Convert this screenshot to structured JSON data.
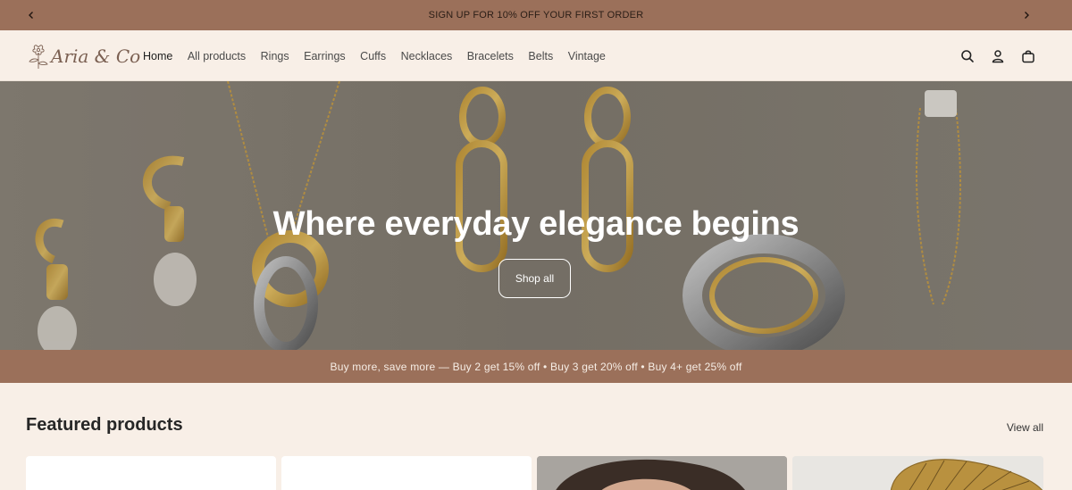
{
  "announcement": {
    "text": "SIGN UP FOR 10% OFF YOUR FIRST ORDER",
    "prev_icon": "chevron-left-icon",
    "next_icon": "chevron-right-icon"
  },
  "header": {
    "logo_text": "Aria & Co",
    "nav": [
      {
        "label": "Home",
        "active": true
      },
      {
        "label": "All products"
      },
      {
        "label": "Rings"
      },
      {
        "label": "Earrings"
      },
      {
        "label": "Cuffs"
      },
      {
        "label": "Necklaces"
      },
      {
        "label": "Bracelets"
      },
      {
        "label": "Belts"
      },
      {
        "label": "Vintage"
      }
    ],
    "icons": [
      "search-icon",
      "account-icon",
      "cart-icon"
    ]
  },
  "hero": {
    "title": "Where everyday elegance begins",
    "button_label": "Shop all"
  },
  "promo": {
    "text": "Buy more, save more — Buy 2 get 15% off • Buy 3 get 20% off • Buy 4+ get 25% off"
  },
  "featured": {
    "title": "Featured products",
    "view_all_label": "View all"
  },
  "colors": {
    "accent": "#9b705a",
    "background": "#f8efe7"
  }
}
